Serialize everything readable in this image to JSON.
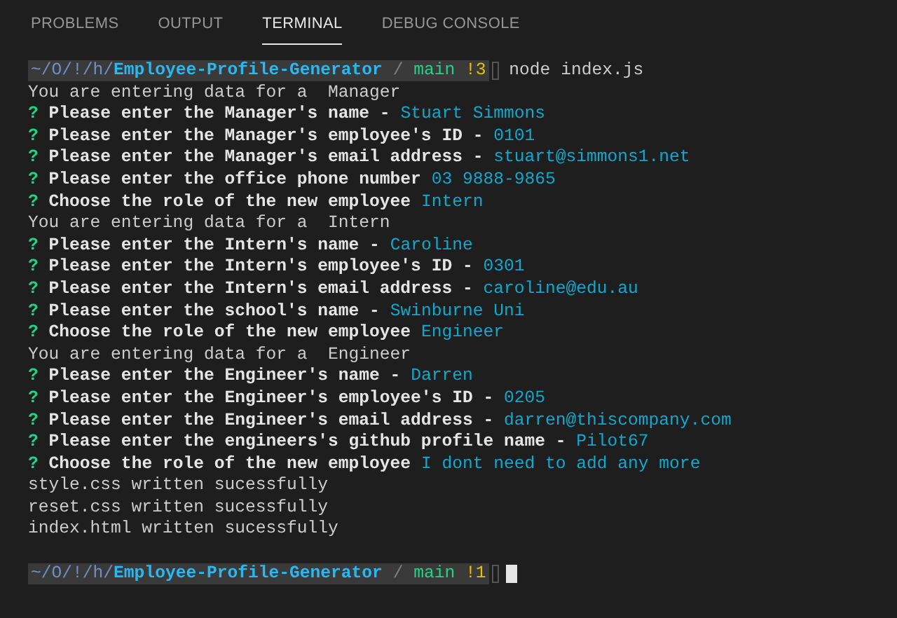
{
  "tabs": [
    {
      "label": "PROBLEMS",
      "selected": false
    },
    {
      "label": "OUTPUT",
      "selected": false
    },
    {
      "label": "TERMINAL",
      "selected": true
    },
    {
      "label": "DEBUG CONSOLE",
      "selected": false
    }
  ],
  "terminal": {
    "lines": [
      {
        "kind": "prompt",
        "path_prefix": "~/O/!/h/",
        "directory": "Employee-Profile-Generator",
        "separator": "/",
        "branch": "main",
        "git_status": "!3",
        "command": "node index.js",
        "cursor": false
      },
      {
        "kind": "output",
        "text": "You are entering data for a  Manager"
      },
      {
        "kind": "question",
        "mark": "?",
        "question": "Please enter the Manager's name -",
        "answer": "Stuart Simmons"
      },
      {
        "kind": "question",
        "mark": "?",
        "question": "Please enter the Manager's employee's ID -",
        "answer": "0101"
      },
      {
        "kind": "question",
        "mark": "?",
        "question": "Please enter the Manager's email address -",
        "answer": "stuart@simmons1.net"
      },
      {
        "kind": "question",
        "mark": "?",
        "question": "Please enter the office phone number",
        "answer": "03 9888-9865"
      },
      {
        "kind": "question",
        "mark": "?",
        "question": "Choose the role of the new employee",
        "answer": "Intern"
      },
      {
        "kind": "output",
        "text": "You are entering data for a  Intern"
      },
      {
        "kind": "question",
        "mark": "?",
        "question": "Please enter the Intern's name -",
        "answer": "Caroline"
      },
      {
        "kind": "question",
        "mark": "?",
        "question": "Please enter the Intern's employee's ID -",
        "answer": "0301"
      },
      {
        "kind": "question",
        "mark": "?",
        "question": "Please enter the Intern's email address -",
        "answer": "caroline@edu.au"
      },
      {
        "kind": "question",
        "mark": "?",
        "question": "Please enter the school's name -",
        "answer": "Swinburne Uni"
      },
      {
        "kind": "question",
        "mark": "?",
        "question": "Choose the role of the new employee",
        "answer": "Engineer"
      },
      {
        "kind": "output",
        "text": "You are entering data for a  Engineer"
      },
      {
        "kind": "question",
        "mark": "?",
        "question": "Please enter the Engineer's name -",
        "answer": "Darren"
      },
      {
        "kind": "question",
        "mark": "?",
        "question": "Please enter the Engineer's employee's ID -",
        "answer": "0205"
      },
      {
        "kind": "question",
        "mark": "?",
        "question": "Please enter the Engineer's email address -",
        "answer": "darren@thiscompany.com"
      },
      {
        "kind": "question",
        "mark": "?",
        "question": "Please enter the engineers's github profile name -",
        "answer": "Pilot67"
      },
      {
        "kind": "question",
        "mark": "?",
        "question": "Choose the role of the new employee",
        "answer": "I dont need to add any more"
      },
      {
        "kind": "output",
        "text": "style.css written sucessfully"
      },
      {
        "kind": "output",
        "text": "reset.css written sucessfully"
      },
      {
        "kind": "output",
        "text": "index.html written sucessfully"
      },
      {
        "kind": "blank"
      },
      {
        "kind": "prompt",
        "path_prefix": "~/O/!/h/",
        "directory": "Employee-Profile-Generator",
        "separator": "/",
        "branch": "main",
        "git_status": "!1",
        "cursor": true
      }
    ]
  }
}
